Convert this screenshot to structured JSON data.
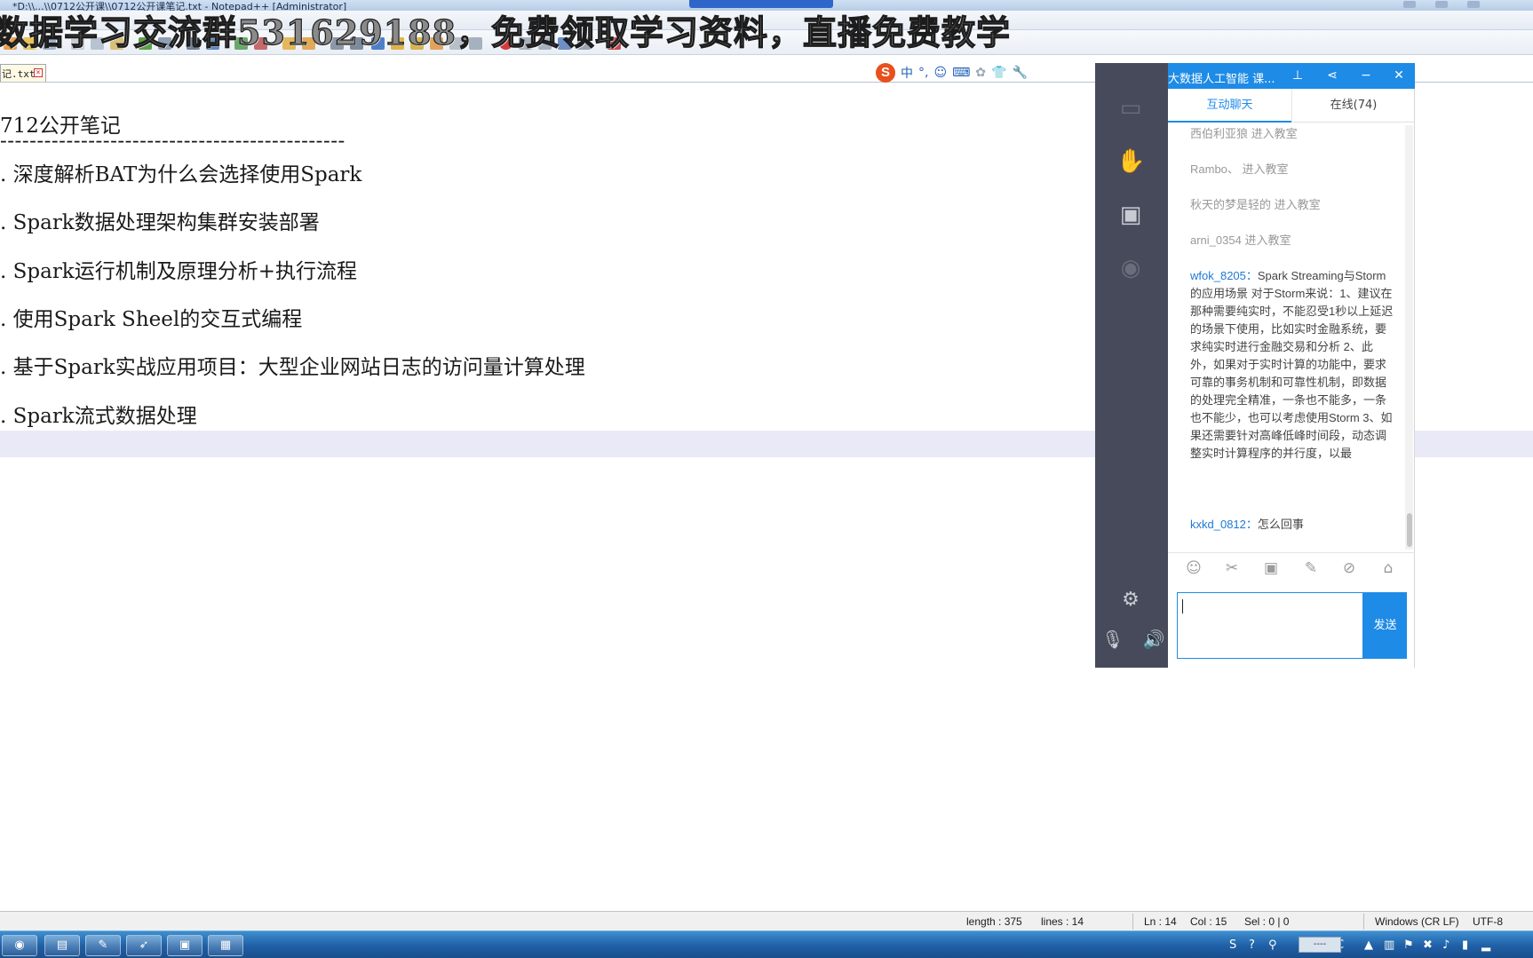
{
  "window": {
    "title": "*D:\\\\...\\\\0712公开课\\\\0712公开课笔记.txt - Notepad++ [Administrator]"
  },
  "overlay": {
    "text": "数据学习交流群531629188，免费领取学习资料，直播免费教学"
  },
  "tab": {
    "label": "记.txt",
    "close_glyph": "×"
  },
  "ime": {
    "logo": "S",
    "items": [
      "中",
      "°,",
      "☺",
      "⌨",
      "✿",
      "👕",
      "🔧"
    ]
  },
  "editor": {
    "lines": [
      "712公开笔记",
      "-----------------------------------------------",
      ". 深度解析BAT为什么会选择使用Spark",
      ". Spark数据处理架构集群安装部署",
      ". Spark运行机制及原理分析+执行流程",
      ". 使用Spark Sheel的交互式编程",
      ". 基于Spark实战应用项目：大型企业网站日志的访问量计算处理",
      ". Spark流式数据处理"
    ]
  },
  "statusbar": {
    "length": "length : 375",
    "lines": "lines : 14",
    "ln": "Ln : 14",
    "col": "Col : 15",
    "sel": "Sel : 0 | 0",
    "eol": "Windows (CR LF)",
    "encoding": "UTF-8"
  },
  "chat": {
    "title": "大数据人工智能 课...",
    "tabs": {
      "interactive": "互动聊天",
      "online": "在线(74)"
    },
    "messages": [
      {
        "user": "",
        "text": "西伯利亚狼 进入教室",
        "type": "system"
      },
      {
        "user": "",
        "text": "Rambo、 进入教室",
        "type": "system"
      },
      {
        "user": "",
        "text": "秋天的梦是轻的 进入教室",
        "type": "system"
      },
      {
        "user": "",
        "text": "arni_0354 进入教室",
        "type": "system"
      },
      {
        "user": "wfok_8205：",
        "text": "Spark Streaming与Storm的应用场景 对于Storm来说：1、建议在那种需要纯实时，不能忍受1秒以上延迟的场景下使用，比如实时金融系统，要求纯实时进行金融交易和分析 2、此外，如果对于实时计算的功能中，要求可靠的事务机制和可靠性机制，即数据的处理完全精准，一条也不能多，一条也不能少，也可以考虑使用Storm 3、如果还需要针对高峰低峰时间段，动态调整实时计算程序的并行度，以最",
        "type": "chat"
      },
      {
        "user": "kxkd_0812：",
        "text": "怎么回事",
        "type": "chat"
      }
    ],
    "send_label": "发送"
  },
  "taskbar": {
    "ime_tray": "----"
  },
  "colors": {
    "accent": "#1e8be6",
    "sidebar": "#474a5a",
    "line_highlight": "#e9e9f8"
  }
}
